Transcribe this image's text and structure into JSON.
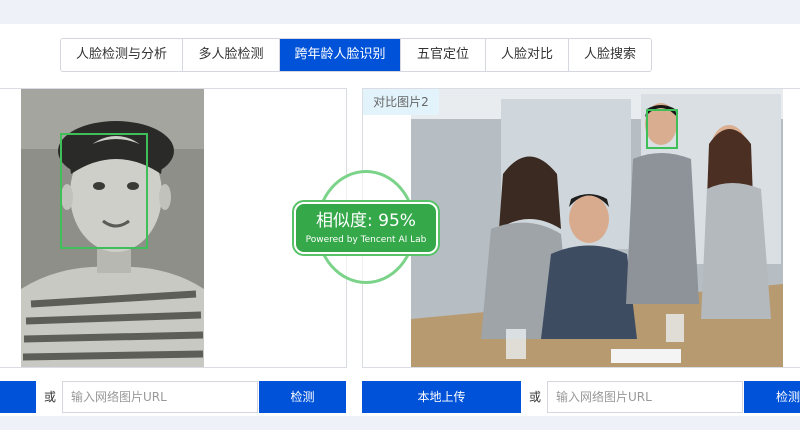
{
  "tabs": [
    {
      "label": "人脸检测与分析",
      "active": false
    },
    {
      "label": "多人脸检测",
      "active": false
    },
    {
      "label": "跨年龄人脸识别",
      "active": true
    },
    {
      "label": "五官定位",
      "active": false
    },
    {
      "label": "人脸对比",
      "active": false
    },
    {
      "label": "人脸搜索",
      "active": false
    }
  ],
  "right_panel": {
    "tag": "对比图片2"
  },
  "badge": {
    "score": "相似度: 95%",
    "powered": "Powered by Tencent AI Lab"
  },
  "left_controls": {
    "or": "或",
    "url_placeholder": "输入网络图片URL",
    "detect_label": "检测"
  },
  "right_controls": {
    "upload_label": "本地上传",
    "or": "或",
    "url_placeholder": "输入网络图片URL",
    "detect_label": "检测"
  },
  "colors": {
    "accent": "#0052d9",
    "face_box": "#3fbf58",
    "badge": "#35a84a"
  }
}
